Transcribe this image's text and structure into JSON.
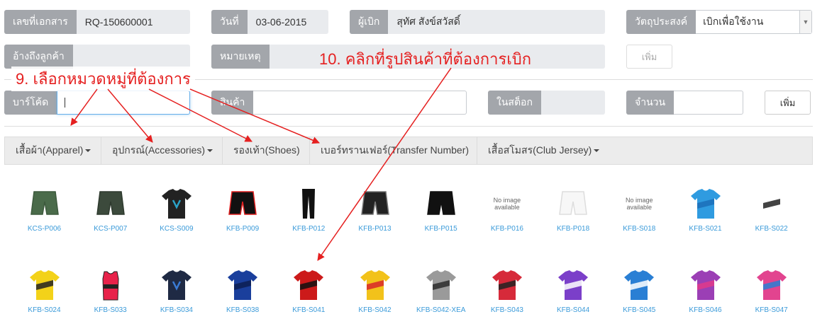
{
  "header": {
    "doc_no": {
      "label": "เลขที่เอกสาร",
      "value": "RQ-150600001"
    },
    "date": {
      "label": "วันที่",
      "value": "03-06-2015"
    },
    "requester": {
      "label": "ผู้เบิก",
      "value": "สุทัศ สังข์สวัสดิ์"
    },
    "purpose": {
      "label": "วัตถุประสงค์",
      "value": "เบิกเพื่อใช้งาน"
    },
    "customer_ref": {
      "label": "อ้างถึงลูกค้า",
      "value": ""
    },
    "note": {
      "label": "หมายเหตุ",
      "value": ""
    },
    "add_label": "เพิ่ม"
  },
  "entry": {
    "barcode": {
      "label": "บาร์โค้ด",
      "value": ""
    },
    "product": {
      "label": "สินค้า",
      "value": ""
    },
    "stock": {
      "label": "ในสต็อก",
      "value": ""
    },
    "qty": {
      "label": "จำนวน",
      "value": ""
    },
    "add_label": "เพิ่ม"
  },
  "categories": [
    {
      "label": "เสื้อผ้า(Apparel)",
      "dropdown": true
    },
    {
      "label": "อุปกรณ์(Accessories)",
      "dropdown": true
    },
    {
      "label": "รองเท้า(Shoes)",
      "dropdown": false
    },
    {
      "label": "เบอร์ทรานเฟอร์(Transfer Number)",
      "dropdown": false
    },
    {
      "label": "เสื้อสโมสร(Club Jersey)",
      "dropdown": true
    }
  ],
  "products": [
    {
      "code": "KCS-P006",
      "kind": "shorts",
      "colors": [
        "#4a6b4a",
        "#3d5a3d"
      ]
    },
    {
      "code": "KCS-P007",
      "kind": "shorts",
      "colors": [
        "#3c4a3c",
        "#2e3a2e"
      ]
    },
    {
      "code": "KCS-S009",
      "kind": "tee",
      "colors": [
        "#222222",
        "#2aa3c9"
      ]
    },
    {
      "code": "KFB-P009",
      "kind": "shorts",
      "colors": [
        "#111111",
        "#e02020"
      ]
    },
    {
      "code": "KFB-P012",
      "kind": "pants",
      "colors": [
        "#111111",
        "#111111"
      ]
    },
    {
      "code": "KFB-P013",
      "kind": "shorts",
      "colors": [
        "#222222",
        "#777777"
      ]
    },
    {
      "code": "KFB-P015",
      "kind": "shorts",
      "colors": [
        "#111111",
        "#111111"
      ]
    },
    {
      "code": "KFB-P016",
      "kind": "none",
      "no_image": "No image available"
    },
    {
      "code": "KFB-P018",
      "kind": "shorts",
      "colors": [
        "#f7f7f7",
        "#dddddd"
      ]
    },
    {
      "code": "KFB-S018",
      "kind": "none",
      "no_image": "No image available"
    },
    {
      "code": "KFB-S021",
      "kind": "jersey",
      "colors": [
        "#2f9be0",
        "#1b6fb8"
      ]
    },
    {
      "code": "KFB-S022",
      "kind": "jersey",
      "colors": [
        "#ffffff",
        "#222222"
      ]
    },
    {
      "code": "KFB-S024",
      "kind": "jersey",
      "colors": [
        "#f3d219",
        "#222222"
      ]
    },
    {
      "code": "KFB-S033",
      "kind": "vest",
      "colors": [
        "#e8224a",
        "#222222"
      ]
    },
    {
      "code": "KFB-S034",
      "kind": "tee",
      "colors": [
        "#1f2a44",
        "#3a7bd5"
      ]
    },
    {
      "code": "KFB-S038",
      "kind": "jersey",
      "colors": [
        "#1a3f9c",
        "#0d1f52"
      ]
    },
    {
      "code": "KFB-S041",
      "kind": "jersey",
      "colors": [
        "#cc1a1a",
        "#111111"
      ]
    },
    {
      "code": "KFB-S042",
      "kind": "jersey",
      "colors": [
        "#f2c21a",
        "#d8262a"
      ]
    },
    {
      "code": "KFB-S042-XEA",
      "kind": "jersey",
      "colors": [
        "#9a9a9a",
        "#2b2b2b"
      ]
    },
    {
      "code": "KFB-S043",
      "kind": "jersey",
      "colors": [
        "#d62a3a",
        "#222222"
      ]
    },
    {
      "code": "KFB-S044",
      "kind": "jersey",
      "colors": [
        "#7b3fc9",
        "#ffffff"
      ]
    },
    {
      "code": "KFB-S045",
      "kind": "jersey",
      "colors": [
        "#2a7fd4",
        "#ffffff"
      ]
    },
    {
      "code": "KFB-S046",
      "kind": "jersey",
      "colors": [
        "#9b3fb5",
        "#e23a8a"
      ]
    },
    {
      "code": "KFB-S047",
      "kind": "jersey",
      "colors": [
        "#e2448f",
        "#2a7fd4"
      ]
    }
  ],
  "annotations": {
    "step9": "9. เลือกหมวดหมู่ที่ต้องการ",
    "step10": "10. คลิกที่รูปสินค้าที่ต้องการเบิก",
    "color": "#e52020"
  }
}
